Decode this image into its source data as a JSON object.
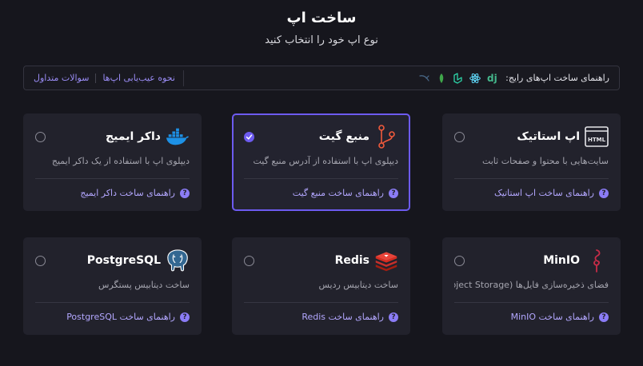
{
  "header": {
    "title": "ساخت اپ",
    "subtitle": "نوع اپ خود را انتخاب کنید"
  },
  "guides": {
    "label": "راهنمای ساخت اپ‌های رایج:",
    "icons": [
      "django-icon",
      "react-icon",
      "laravel-icon",
      "nodejs-icon",
      "mysql-icon"
    ],
    "links": [
      {
        "label": "نحوه عیب‌یابی اپ‌ها"
      },
      {
        "label": "سوالات متداول"
      }
    ]
  },
  "cards": [
    {
      "id": "static",
      "name": "اپ استاتیک",
      "icon": "html-icon",
      "description": "سایت‌هایی با محتوا و صفحات ثابت",
      "link": "راهنمای ساخت اپ استاتیک",
      "selected": false
    },
    {
      "id": "git",
      "name": "منبع گیت",
      "icon": "git-icon",
      "description": "دیپلوی اپ با استفاده از آدرس منبع گیت",
      "link": "راهنمای ساخت منبع گیت",
      "selected": true
    },
    {
      "id": "docker",
      "name": "داکر ایمیج",
      "icon": "docker-icon",
      "description": "دیپلوی اپ با استفاده از یک داکر ایمیج",
      "link": "راهنمای ساخت داکر ایمیج",
      "selected": false
    },
    {
      "id": "minio",
      "name": "MinIO",
      "icon": "minio-icon",
      "description": "فضای ذخیره‌سازی فایل‌ها (Object Storage)",
      "link": "راهنمای ساخت MinIO",
      "selected": false
    },
    {
      "id": "redis",
      "name": "Redis",
      "icon": "redis-icon",
      "description": "ساخت دیتابیس ردیس",
      "link": "راهنمای ساخت Redis",
      "selected": false
    },
    {
      "id": "postgres",
      "name": "PostgreSQL",
      "icon": "postgresql-icon",
      "description": "ساخت دیتابیس پستگرس",
      "link": "راهنمای ساخت PostgreSQL",
      "selected": false
    }
  ],
  "colors": {
    "background": "#16161d",
    "card": "#22222c",
    "accent": "#6d5bf0",
    "link": "#b3a7ff"
  }
}
